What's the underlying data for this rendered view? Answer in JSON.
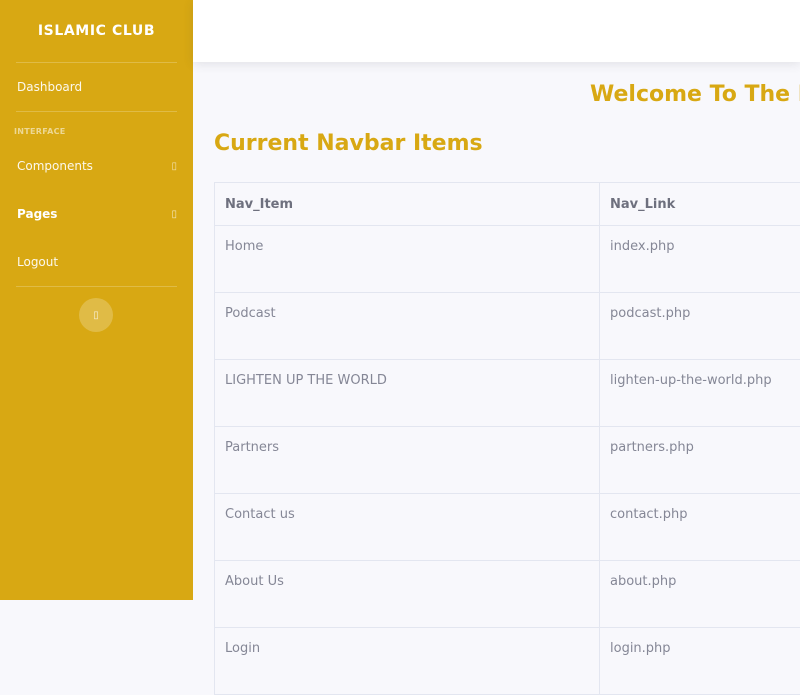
{
  "sidebar": {
    "brand": "ISLAMIC CLUB",
    "dashboard": "Dashboard",
    "heading": "INTERFACE",
    "components": "Components",
    "pages": "Pages",
    "logout": "Logout",
    "caret_icon": "chevron-right-icon",
    "toggle_icon": "chevron-left-icon"
  },
  "main": {
    "welcome": "Welcome To The D",
    "section_title": "Current Navbar Items",
    "accent_color": "#d8a813",
    "table": {
      "headers": [
        "Nav_Item",
        "Nav_Link"
      ],
      "rows": [
        [
          "Home",
          "index.php"
        ],
        [
          "Podcast",
          "podcast.php"
        ],
        [
          "LIGHTEN UP THE WORLD",
          "lighten-up-the-world.php"
        ],
        [
          "Partners",
          "partners.php"
        ],
        [
          "Contact us",
          "contact.php"
        ],
        [
          "About Us",
          "about.php"
        ],
        [
          "Login",
          "login.php"
        ]
      ]
    }
  }
}
